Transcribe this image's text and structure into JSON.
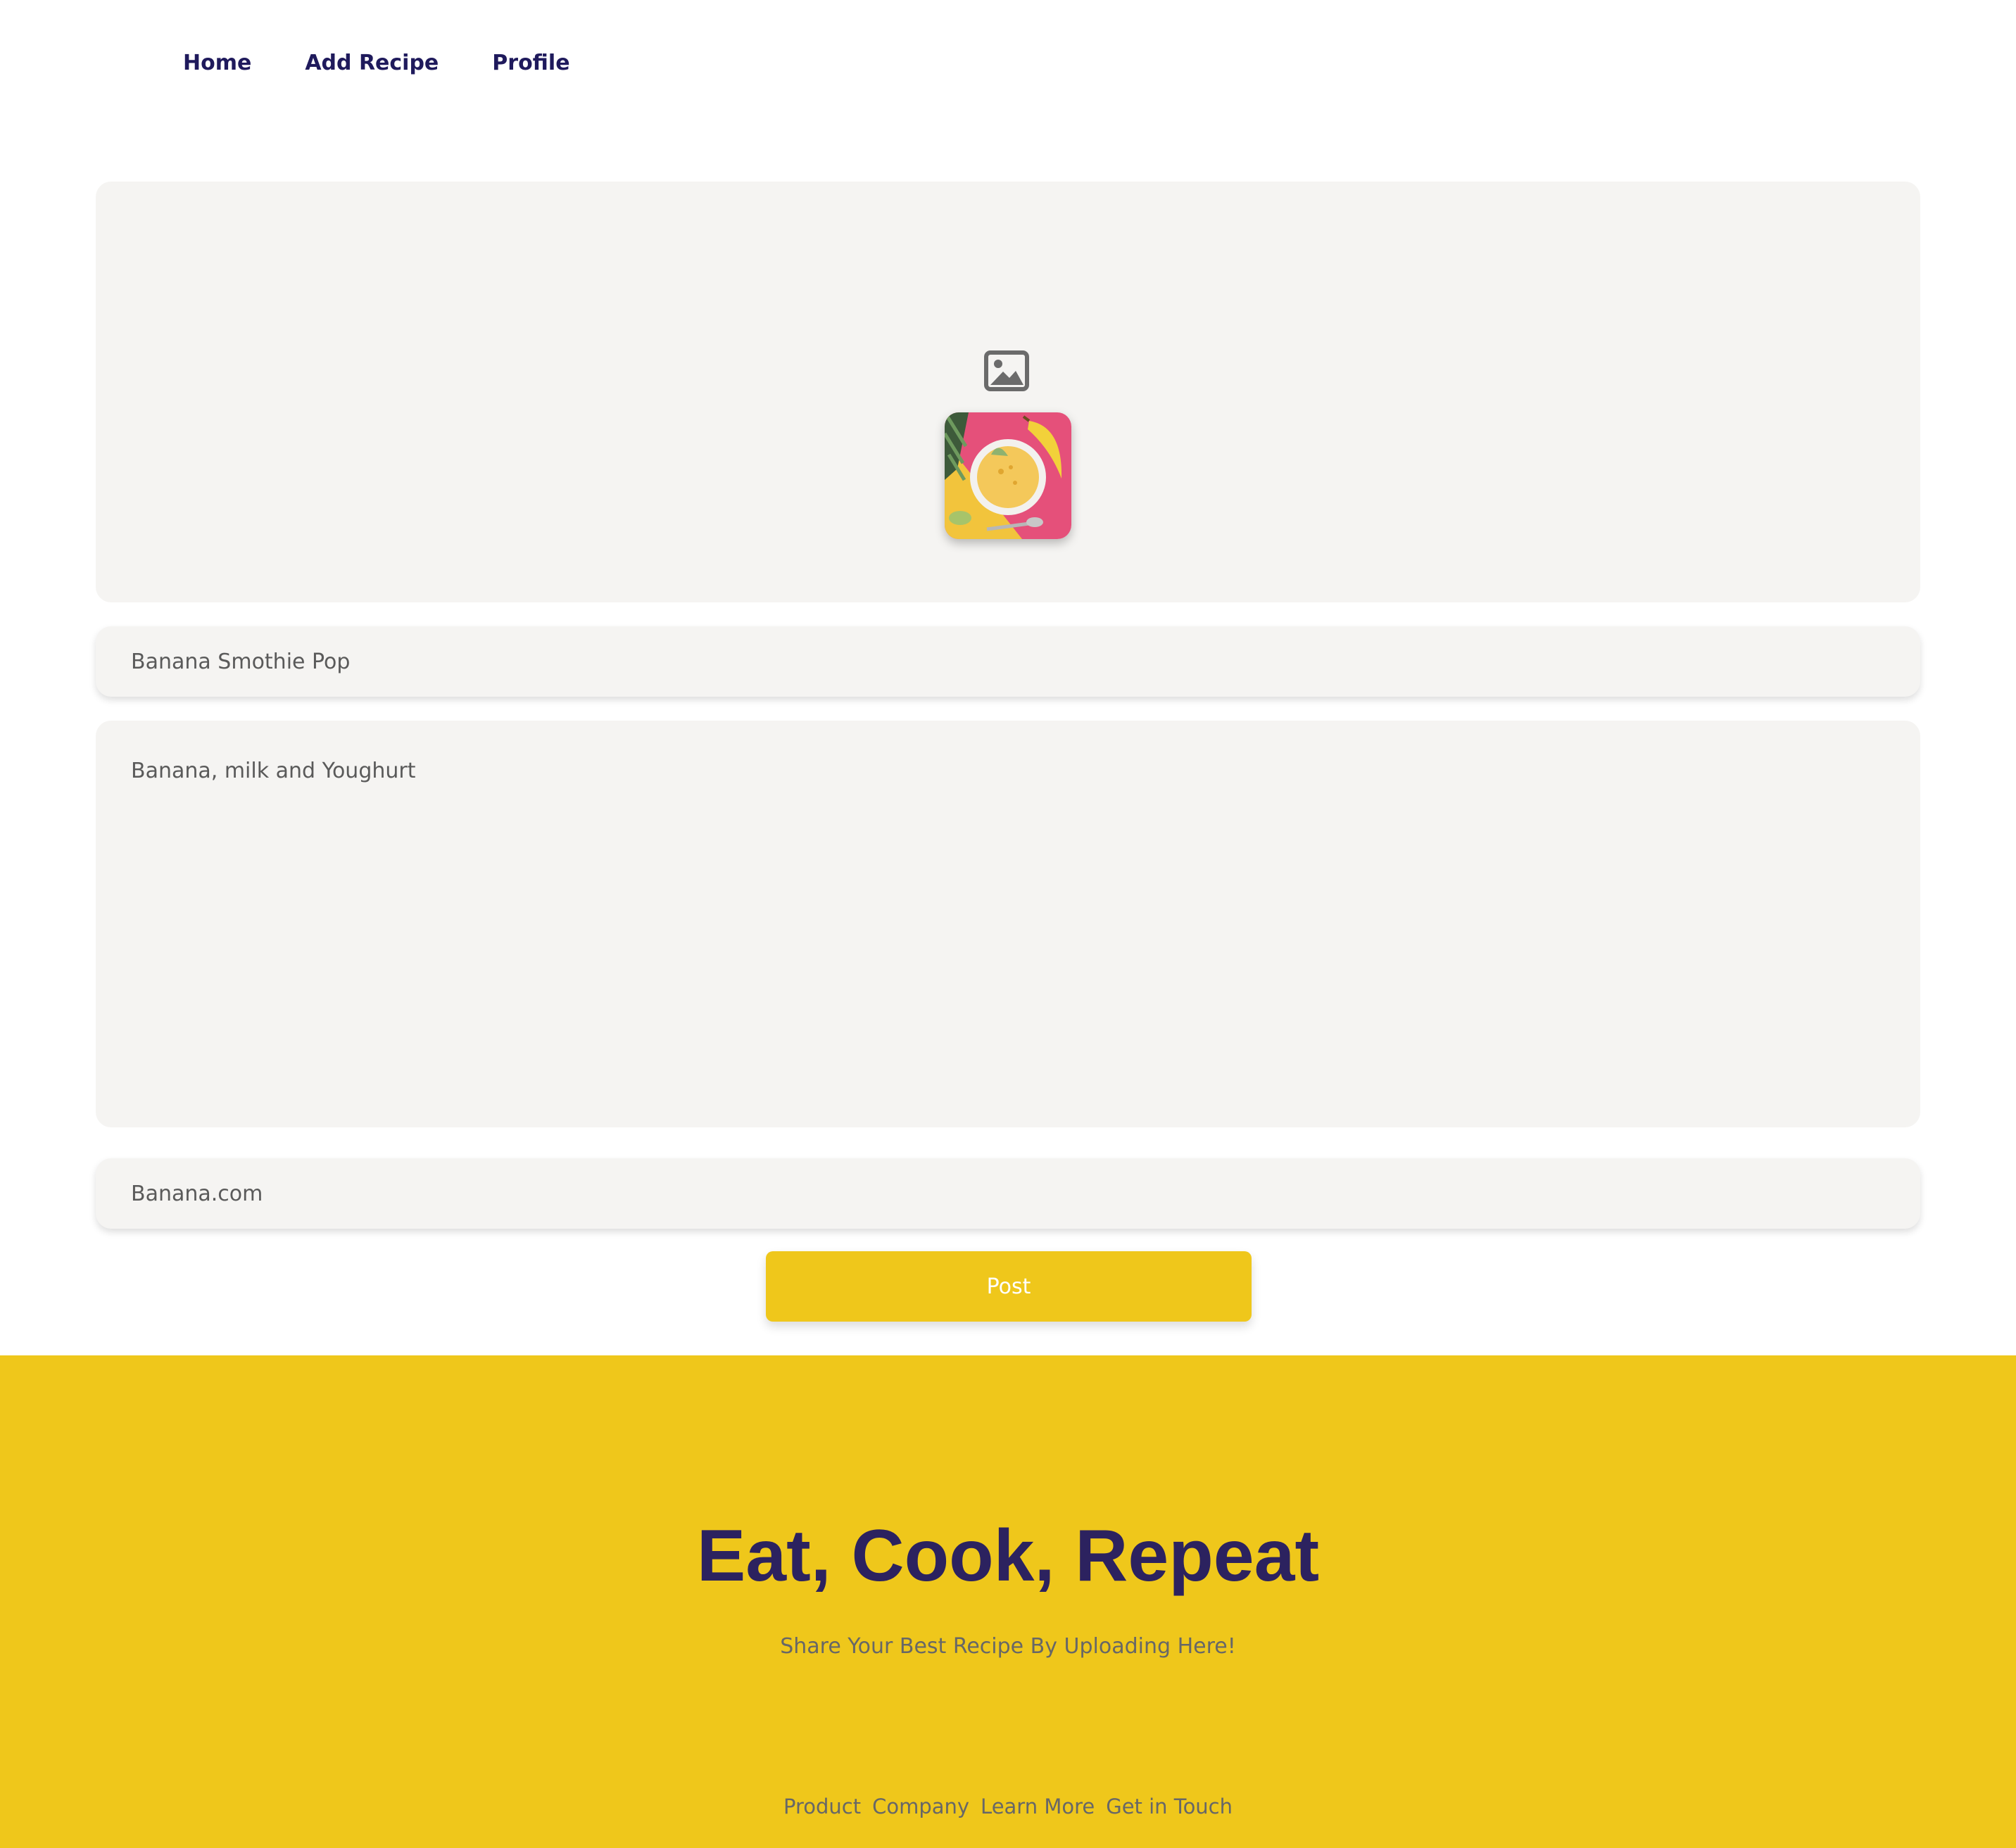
{
  "nav": {
    "items": [
      {
        "label": "Home"
      },
      {
        "label": "Add Recipe"
      },
      {
        "label": "Profile"
      }
    ]
  },
  "form": {
    "upload_icon": "image-icon",
    "title_value": "Banana Smothie Pop",
    "description_value": "Banana, milk and Youghurt",
    "link_value": "Banana.com",
    "post_label": "Post"
  },
  "footer": {
    "title": "Eat, Cook, Repeat",
    "subtitle": "Share Your Best Recipe By Uploading Here!",
    "links": [
      {
        "label": "Product"
      },
      {
        "label": "Company"
      },
      {
        "label": "Learn More"
      },
      {
        "label": "Get in Touch"
      }
    ]
  },
  "colors": {
    "accent_yellow": "#efc71b",
    "nav_text": "#1f1a5c",
    "footer_title": "#2c225f",
    "field_bg": "#f5f4f2"
  }
}
